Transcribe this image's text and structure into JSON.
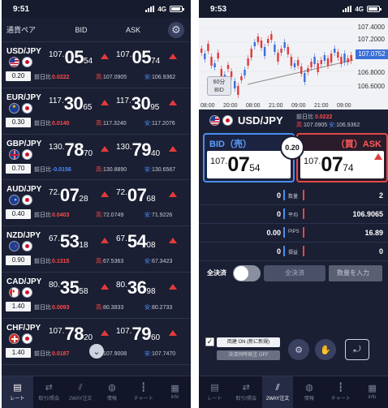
{
  "left": {
    "status": {
      "time": "9:51",
      "network": "4G"
    },
    "header": {
      "pair": "通貨ペア",
      "bid": "BID",
      "ask": "ASK"
    },
    "rows": [
      {
        "pair": "USD/JPY",
        "flags": [
          "us",
          "jp"
        ],
        "spread": "0.20",
        "bid": {
          "small": "107.",
          "big": "05",
          "pip": "54"
        },
        "ask": {
          "small": "107.",
          "big": "05",
          "pip": "74"
        },
        "change_label": "前日比",
        "change": "0.0222",
        "change_dir": "up",
        "high_label": "高:",
        "high": "107.0905",
        "low_label": "安:",
        "low": "106.9362"
      },
      {
        "pair": "EUR/JPY",
        "flags": [
          "eu",
          "jp"
        ],
        "spread": "0.30",
        "bid": {
          "small": "117.",
          "big": "30",
          "pip": "65"
        },
        "ask": {
          "small": "117.",
          "big": "30",
          "pip": "95"
        },
        "change_label": "前日比",
        "change": "0.0140",
        "change_dir": "up",
        "high_label": "高:",
        "high": "117.3240",
        "low_label": "安:",
        "low": "117.2076"
      },
      {
        "pair": "GBP/JPY",
        "flags": [
          "gb",
          "jp"
        ],
        "spread": "0.70",
        "bid": {
          "small": "130.",
          "big": "78",
          "pip": "70"
        },
        "ask": {
          "small": "130.",
          "big": "79",
          "pip": "40"
        },
        "change_label": "前日比",
        "change": "-0.0156",
        "change_dir": "down",
        "high_label": "高:",
        "high": "130.8890",
        "low_label": "安:",
        "low": "130.6567"
      },
      {
        "pair": "AUD/JPY",
        "flags": [
          "au",
          "jp"
        ],
        "spread": "0.40",
        "bid": {
          "small": "72.",
          "big": "07",
          "pip": "28"
        },
        "ask": {
          "small": "72.",
          "big": "07",
          "pip": "68"
        },
        "change_label": "前日比",
        "change": "0.0403",
        "change_dir": "up",
        "high_label": "高:",
        "high": "72.0749",
        "low_label": "安:",
        "low": "71.9226"
      },
      {
        "pair": "NZD/JPY",
        "flags": [
          "nz",
          "jp"
        ],
        "spread": "0.90",
        "bid": {
          "small": "67.",
          "big": "53",
          "pip": "18"
        },
        "ask": {
          "small": "67.",
          "big": "54",
          "pip": "08"
        },
        "change_label": "前日比",
        "change": "0.1315",
        "change_dir": "up",
        "high_label": "高:",
        "high": "67.5363",
        "low_label": "安:",
        "low": "67.3423"
      },
      {
        "pair": "CAD/JPY",
        "flags": [
          "ca",
          "jp"
        ],
        "spread": "1.40",
        "bid": {
          "small": "80.",
          "big": "35",
          "pip": "58"
        },
        "ask": {
          "small": "80.",
          "big": "36",
          "pip": "98"
        },
        "change_label": "前日比",
        "change": "0.0093",
        "change_dir": "up",
        "high_label": "高:",
        "high": "80.3833",
        "low_label": "安:",
        "low": "80.2733"
      },
      {
        "pair": "CHF/JPY",
        "flags": [
          "ch",
          "jp"
        ],
        "spread": "1.40",
        "bid": {
          "small": "107.",
          "big": "78",
          "pip": "20"
        },
        "ask": {
          "small": "107.",
          "big": "79",
          "pip": "60"
        },
        "change_label": "前日比",
        "change": "0.0187",
        "change_dir": "up",
        "high_label": "高:",
        "high": "107.9008",
        "low_label": "安:",
        "low": "107.7470"
      }
    ],
    "tabs": [
      {
        "label": "レート",
        "icon": "▤",
        "active": true
      },
      {
        "label": "取引/照会",
        "icon": "⇄",
        "active": false
      },
      {
        "label": "2WAY注文",
        "icon": "⫽",
        "active": false
      },
      {
        "label": "情報",
        "icon": "◍",
        "active": false
      },
      {
        "label": "チャート",
        "icon": "┇",
        "active": false
      },
      {
        "label": "info",
        "icon": "▦",
        "active": false
      }
    ]
  },
  "right": {
    "status": {
      "time": "9:53",
      "network": "4G"
    },
    "chart": {
      "y_labels": [
        "107.4000",
        "107.2000",
        "107.0752",
        "106.8000",
        "106.6000"
      ],
      "x_labels": [
        "08:00",
        "20:00",
        "08:00",
        "21:00",
        "09:00",
        "21:00",
        "09:00"
      ],
      "timeframe": "60分",
      "timeframe_side": "BID",
      "current_price_color": "#3a6fd8"
    },
    "pair": "USD/JPY",
    "change_label": "前日比",
    "change": "0.0222",
    "high_label": "高:",
    "high": "107.0905",
    "low_label": "安:",
    "low": "106.9362",
    "bid_label": "BID（売）",
    "ask_label": "（買）ASK",
    "spread": "0.20",
    "bid": {
      "small": "107.",
      "big": "07",
      "pip": "54"
    },
    "ask": {
      "small": "107.",
      "big": "07",
      "pip": "74"
    },
    "stats": [
      {
        "label": "数量",
        "left": "0",
        "right": "2"
      },
      {
        "label": "平均",
        "left": "0",
        "right": "106.9065"
      },
      {
        "label": "PIPS",
        "left": "0.00",
        "right": "16.89"
      },
      {
        "label": "損益",
        "left": "0",
        "right": "0"
      }
    ],
    "close_all": "全決済",
    "close_button": "全決済",
    "qty_placeholder": "数量を入力",
    "option1": "両建 ON (新に新規)",
    "option2": "決済同時発注 OFF",
    "tabs": [
      {
        "label": "レート",
        "icon": "▤",
        "active": false
      },
      {
        "label": "取引/照会",
        "icon": "⇄",
        "active": false
      },
      {
        "label": "2WAY注文",
        "icon": "⫽",
        "active": true
      },
      {
        "label": "情報",
        "icon": "◍",
        "active": false
      },
      {
        "label": "チャート",
        "icon": "┇",
        "active": false
      },
      {
        "label": "info",
        "icon": "▦",
        "active": false
      }
    ]
  }
}
